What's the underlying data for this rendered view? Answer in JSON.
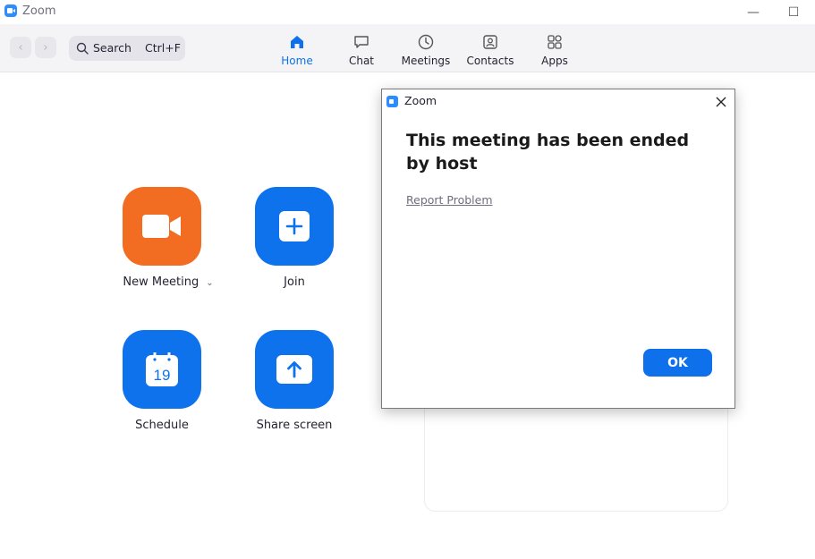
{
  "window": {
    "title": "Zoom",
    "minimize_glyph": "—",
    "maximize_glyph": "☐"
  },
  "toolbar": {
    "search_label": "Search",
    "search_shortcut": "Ctrl+F",
    "tabs": [
      {
        "label": "Home",
        "icon": "home-icon",
        "active": true
      },
      {
        "label": "Chat",
        "icon": "chat-icon",
        "active": false
      },
      {
        "label": "Meetings",
        "icon": "clock-icon",
        "active": false
      },
      {
        "label": "Contacts",
        "icon": "contacts-icon",
        "active": false
      },
      {
        "label": "Apps",
        "icon": "apps-icon",
        "active": false
      }
    ]
  },
  "home": {
    "actions": [
      {
        "label": "New Meeting",
        "icon": "video-camera-icon",
        "color": "#f26d21"
      },
      {
        "label": "Join",
        "icon": "plus-icon",
        "color": "#0e72ed"
      },
      {
        "label": "Schedule",
        "icon": "calendar-icon",
        "color": "#0e72ed",
        "calendar_day": "19"
      },
      {
        "label": "Share screen",
        "icon": "share-arrow-icon",
        "color": "#0e72ed"
      }
    ]
  },
  "dialog": {
    "title": "Zoom",
    "message": "This meeting has been ended by host",
    "link": "Report Problem",
    "ok_label": "OK"
  },
  "colors": {
    "accent": "#0e71eb",
    "orange": "#f26d21"
  }
}
